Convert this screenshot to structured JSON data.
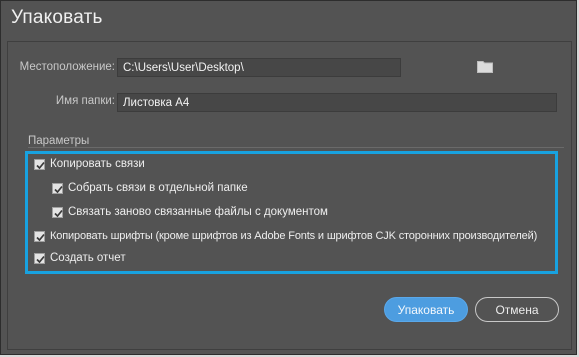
{
  "dialog": {
    "title": "Упаковать"
  },
  "location": {
    "label": "Местоположение:",
    "value": "C:\\Users\\User\\Desktop\\"
  },
  "folder_name": {
    "label": "Имя папки:",
    "value": "Листовка А4"
  },
  "options": {
    "section_label": "Параметры",
    "copy_links": {
      "label": "Копировать связи",
      "checked": true
    },
    "collect_links": {
      "label": "Собрать связи в отдельной папке",
      "checked": true
    },
    "relink_files": {
      "label": "Связать заново связанные файлы с документом",
      "checked": true
    },
    "copy_fonts": {
      "label": "Копировать шрифты (кроме шрифтов из Adobe Fonts и шрифтов CJK сторонних производителей)",
      "checked": true
    },
    "create_report": {
      "label": "Создать отчет",
      "checked": true
    }
  },
  "buttons": {
    "package_label": "Упаковать",
    "cancel_label": "Отмена"
  },
  "colors": {
    "dialog_bg": "#535353",
    "highlight": "#18a2e0",
    "primary_button": "#4d9de0"
  },
  "icons": {
    "folder": "folder-icon",
    "checkbox": "checkmark-icon"
  }
}
